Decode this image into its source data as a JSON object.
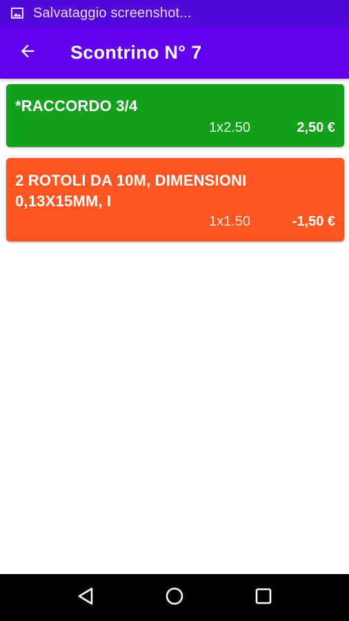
{
  "status_bar": {
    "notification_text": "Salvataggio screenshot...",
    "icon": "image-icon"
  },
  "app_bar": {
    "back_icon": "arrow-back-icon",
    "title": "Scontrino N° 7",
    "background": "#6200ee"
  },
  "items": [
    {
      "name": "*RACCORDO 3/4",
      "qty_price": "1x2.50",
      "total": "2,50 €",
      "color": "#13a11c"
    },
    {
      "name": "2 ROTOLI DA 10M, DIMENSIONI 0,13X15MM, I",
      "qty_price": "1x1.50",
      "total": "-1,50 €",
      "color": "#fd5622"
    }
  ],
  "nav_bar": {
    "back_icon": "triangle-back-icon",
    "home_icon": "circle-home-icon",
    "recents_icon": "square-recents-icon"
  }
}
